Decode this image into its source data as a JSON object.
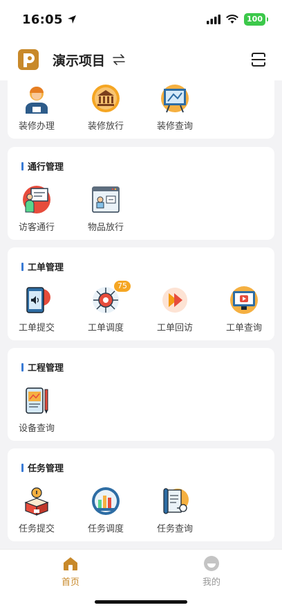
{
  "status_bar": {
    "time": "16:05",
    "battery": "100"
  },
  "header": {
    "project_title": "演示项目"
  },
  "sections": {
    "decoration": {
      "items": [
        {
          "label": "装修办理",
          "icon": "worker-icon"
        },
        {
          "label": "装修放行",
          "icon": "bank-icon"
        },
        {
          "label": "装修查询",
          "icon": "blueprint-board-icon"
        }
      ]
    },
    "access": {
      "title": "通行管理",
      "items": [
        {
          "label": "访客通行",
          "icon": "visitor-icon"
        },
        {
          "label": "物品放行",
          "icon": "package-window-icon"
        }
      ]
    },
    "workorder": {
      "title": "工单管理",
      "items": [
        {
          "label": "工单提交",
          "icon": "phone-speaker-icon"
        },
        {
          "label": "工单调度",
          "icon": "dispatch-gear-icon",
          "badge": "75"
        },
        {
          "label": "工单回访",
          "icon": "play-icon"
        },
        {
          "label": "工单查询",
          "icon": "monitor-icon"
        }
      ]
    },
    "engineering": {
      "title": "工程管理",
      "items": [
        {
          "label": "设备查询",
          "icon": "tablet-pen-icon"
        }
      ]
    },
    "tasks": {
      "title": "任务管理",
      "items": [
        {
          "label": "任务提交",
          "icon": "idea-box-icon"
        },
        {
          "label": "任务调度",
          "icon": "bar-chart-icon"
        },
        {
          "label": "任务查询",
          "icon": "scroll-icon"
        }
      ]
    }
  },
  "tabbar": {
    "tabs": [
      {
        "label": "首页",
        "icon": "home-icon",
        "active": true
      },
      {
        "label": "我的",
        "icon": "profile-icon",
        "active": false
      }
    ]
  },
  "colors": {
    "accent": "#c8892a",
    "section_bar": "#3a7bd5",
    "badge": "#f5a623",
    "battery": "#3cc84a"
  }
}
